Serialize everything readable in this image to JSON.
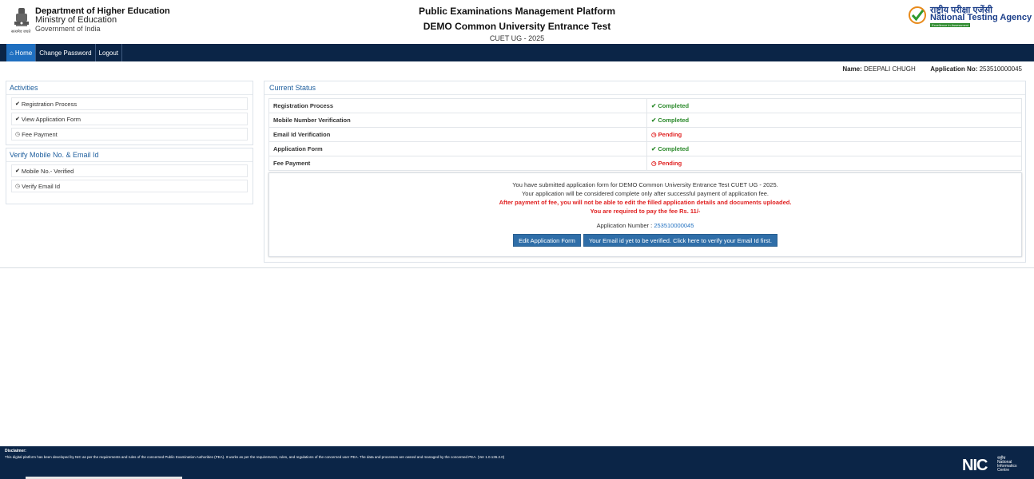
{
  "header": {
    "dept_line1": "Department of Higher Education",
    "dept_line2": "Ministry of Education",
    "dept_line3": "Government of India",
    "emblem_caption": "सत्यमेव जयते",
    "title1": "Public Examinations Management Platform",
    "title2": "DEMO Common University Entrance Test",
    "title3": "CUET UG - 2025",
    "nta_hindi": "राष्ट्रीय परीक्षा एजेंसी",
    "nta_english": "National Testing Agency",
    "nta_tagline": "Excellence in Assessment"
  },
  "nav": {
    "home": "Home",
    "change_password": "Change Password",
    "logout": "Logout"
  },
  "user": {
    "name_label": "Name:",
    "name": "DEEPALI CHUGH",
    "app_label": "Application No:",
    "app_no": "253510000045"
  },
  "activities": {
    "title": "Activities",
    "items": [
      {
        "label": "Registration Process",
        "icon": "check-circle-icon"
      },
      {
        "label": "View Application Form",
        "icon": "check-circle-icon"
      },
      {
        "label": "Fee Payment",
        "icon": "clock-icon"
      }
    ]
  },
  "verify": {
    "title": "Verify Mobile No. & Email Id",
    "items": [
      {
        "label": "Mobile No.- Verified",
        "icon": "check-circle-icon"
      },
      {
        "label": "Verify Email Id",
        "icon": "clock-icon"
      }
    ]
  },
  "status": {
    "title": "Current Status",
    "rows": [
      {
        "label": "Registration Process",
        "value": "Completed"
      },
      {
        "label": "Mobile Number Verification",
        "value": "Completed"
      },
      {
        "label": "Email Id Verification",
        "value": "Pending"
      },
      {
        "label": "Application Form",
        "value": "Completed"
      },
      {
        "label": "Fee Payment",
        "value": "Pending"
      }
    ],
    "message1": "You have submitted application form for DEMO Common University Entrance Test CUET UG - 2025.",
    "message2": "Your application will be considered complete only after successful payment of application fee.",
    "message3": "After payment of fee, you will not be able to edit the filled application details and documents uploaded.",
    "message4": "You are required to pay the fee Rs. 11/-",
    "app_number_label": "Application Number :",
    "app_number": "253510000045",
    "edit_button": "Edit Application Form",
    "verify_button": "Your Email id yet to be verified. Click here to verify your Email Id first."
  },
  "footer": {
    "disclaimer_title": "Disclaimer:",
    "disclaimer": "This digital platform has been developed by NIC as per the requirements and rules of the concerned Public Examination Authorities (PEA). It works as per the requirements, rules, and regulations of the concerned user PEA. The data and processes are owned and managed by the concerned PEA. (Ver 1.0.136.2.0)",
    "nic": "NIC",
    "nic_hindi": "राष्ट्रीय",
    "nic_l1": "National",
    "nic_l2": "Informatics",
    "nic_l3": "Centre"
  },
  "colors": {
    "navy": "#0b2547",
    "active_blue": "#1f6fc0",
    "completed_green": "#2b8a2b",
    "pending_red": "#e02020",
    "button_blue": "#2f6ea8"
  }
}
